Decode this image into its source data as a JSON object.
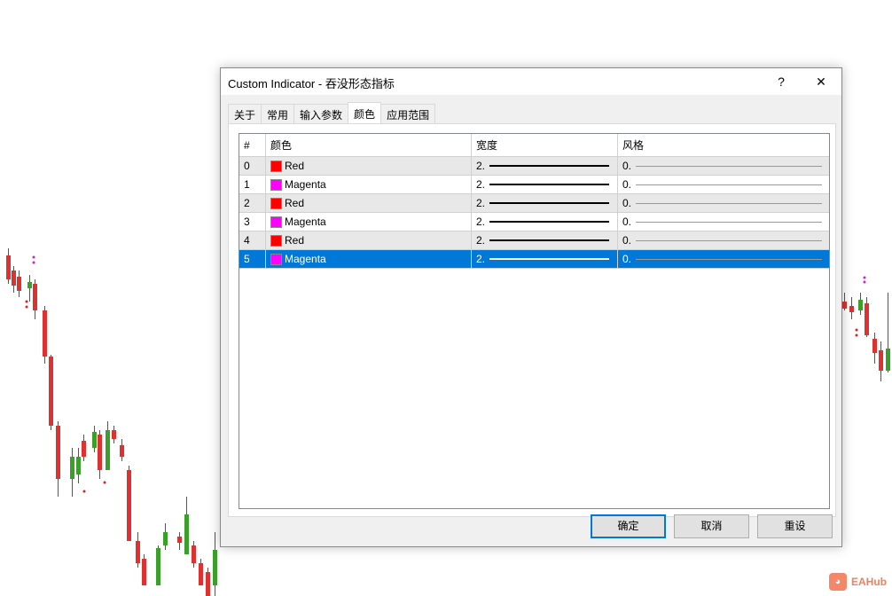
{
  "dialog": {
    "title": "Custom Indicator - 吞没形态指标",
    "help": "?",
    "close": "✕"
  },
  "tabs": [
    {
      "label": "关于"
    },
    {
      "label": "常用"
    },
    {
      "label": "输入参数"
    },
    {
      "label": "颜色",
      "active": true
    },
    {
      "label": "应用范围"
    }
  ],
  "table": {
    "headers": {
      "index": "#",
      "color": "颜色",
      "width": "宽度",
      "style": "风格"
    },
    "rows": [
      {
        "index": "0",
        "color": "Red",
        "hex": "#ff0000",
        "width": "2.",
        "style": "0."
      },
      {
        "index": "1",
        "color": "Magenta",
        "hex": "#ff00ff",
        "width": "2.",
        "style": "0."
      },
      {
        "index": "2",
        "color": "Red",
        "hex": "#ff0000",
        "width": "2.",
        "style": "0."
      },
      {
        "index": "3",
        "color": "Magenta",
        "hex": "#ff00ff",
        "width": "2.",
        "style": "0."
      },
      {
        "index": "4",
        "color": "Red",
        "hex": "#ff0000",
        "width": "2.",
        "style": "0."
      },
      {
        "index": "5",
        "color": "Magenta",
        "hex": "#ff00ff",
        "width": "2.",
        "style": "0.",
        "selected": true
      }
    ]
  },
  "buttons": {
    "ok": "确定",
    "cancel": "取消",
    "reset": "重设"
  },
  "watermark": {
    "text": "EAHub"
  }
}
